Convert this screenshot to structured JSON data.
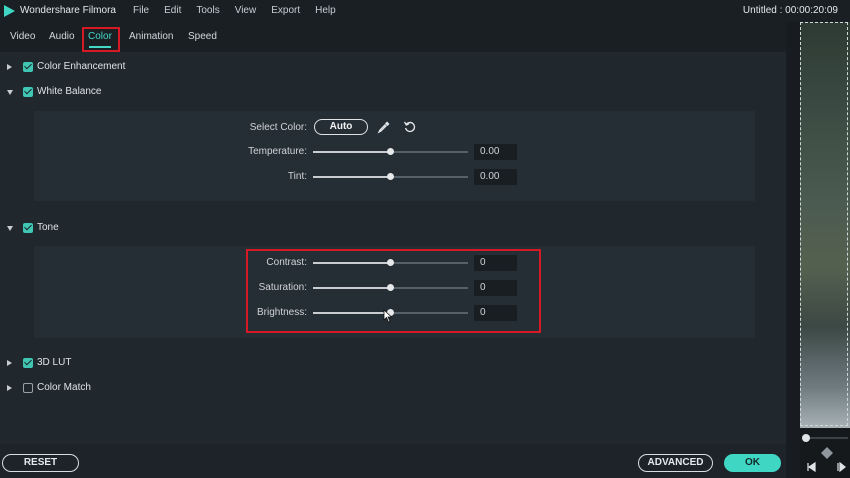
{
  "app": {
    "name": "Wondershare Filmora",
    "menu": [
      "File",
      "Edit",
      "Tools",
      "View",
      "Export",
      "Help"
    ],
    "document": "Untitled : 00:00:20:09"
  },
  "tabs": [
    {
      "label": "Video",
      "active": false
    },
    {
      "label": "Audio",
      "active": false
    },
    {
      "label": "Color",
      "active": true
    },
    {
      "label": "Animation",
      "active": false
    },
    {
      "label": "Speed",
      "active": false
    }
  ],
  "sections": {
    "color_enhancement": {
      "label": "Color Enhancement",
      "checked": true,
      "expanded": false
    },
    "white_balance": {
      "label": "White Balance",
      "checked": true,
      "expanded": true
    },
    "tone": {
      "label": "Tone",
      "checked": true,
      "expanded": true
    },
    "lut_3d": {
      "label": "3D LUT",
      "checked": true,
      "expanded": false
    },
    "color_match": {
      "label": "Color Match",
      "checked": false,
      "expanded": false
    }
  },
  "white_balance": {
    "select_color_label": "Select Color:",
    "auto_label": "Auto",
    "temperature": {
      "label": "Temperature:",
      "value": "0.00",
      "level": 0.5
    },
    "tint": {
      "label": "Tint:",
      "value": "0.00",
      "level": 0.5
    }
  },
  "tone": {
    "contrast": {
      "label": "Contrast:",
      "value": "0",
      "level": 0.5
    },
    "saturation": {
      "label": "Saturation:",
      "value": "0",
      "level": 0.5
    },
    "brightness": {
      "label": "Brightness:",
      "value": "0",
      "level": 0.5
    }
  },
  "footer": {
    "reset_label": "RESET",
    "advanced_label": "ADVANCED",
    "ok_label": "OK"
  },
  "colors": {
    "accent": "#3fd7c4",
    "highlight_box": "#d51a26"
  },
  "icons": {
    "eyedropper": "eyedropper-icon",
    "reset": "reset-icon"
  }
}
